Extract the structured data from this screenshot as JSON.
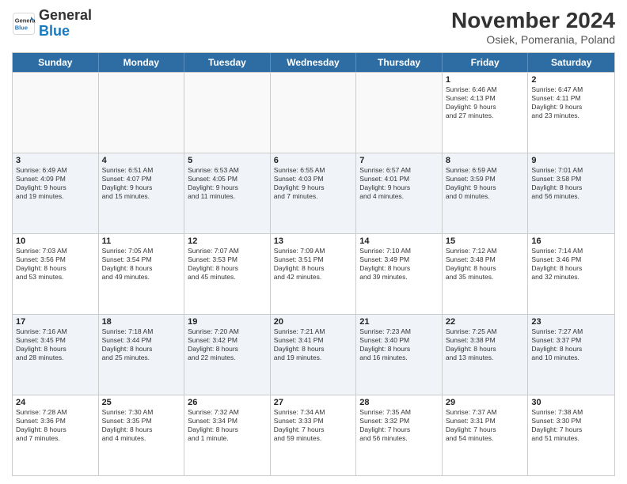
{
  "logo": {
    "general": "General",
    "blue": "Blue"
  },
  "header": {
    "month": "November 2024",
    "location": "Osiek, Pomerania, Poland"
  },
  "weekdays": [
    "Sunday",
    "Monday",
    "Tuesday",
    "Wednesday",
    "Thursday",
    "Friday",
    "Saturday"
  ],
  "rows": [
    [
      {
        "day": "",
        "info": ""
      },
      {
        "day": "",
        "info": ""
      },
      {
        "day": "",
        "info": ""
      },
      {
        "day": "",
        "info": ""
      },
      {
        "day": "",
        "info": ""
      },
      {
        "day": "1",
        "info": "Sunrise: 6:46 AM\nSunset: 4:13 PM\nDaylight: 9 hours\nand 27 minutes."
      },
      {
        "day": "2",
        "info": "Sunrise: 6:47 AM\nSunset: 4:11 PM\nDaylight: 9 hours\nand 23 minutes."
      }
    ],
    [
      {
        "day": "3",
        "info": "Sunrise: 6:49 AM\nSunset: 4:09 PM\nDaylight: 9 hours\nand 19 minutes."
      },
      {
        "day": "4",
        "info": "Sunrise: 6:51 AM\nSunset: 4:07 PM\nDaylight: 9 hours\nand 15 minutes."
      },
      {
        "day": "5",
        "info": "Sunrise: 6:53 AM\nSunset: 4:05 PM\nDaylight: 9 hours\nand 11 minutes."
      },
      {
        "day": "6",
        "info": "Sunrise: 6:55 AM\nSunset: 4:03 PM\nDaylight: 9 hours\nand 7 minutes."
      },
      {
        "day": "7",
        "info": "Sunrise: 6:57 AM\nSunset: 4:01 PM\nDaylight: 9 hours\nand 4 minutes."
      },
      {
        "day": "8",
        "info": "Sunrise: 6:59 AM\nSunset: 3:59 PM\nDaylight: 9 hours\nand 0 minutes."
      },
      {
        "day": "9",
        "info": "Sunrise: 7:01 AM\nSunset: 3:58 PM\nDaylight: 8 hours\nand 56 minutes."
      }
    ],
    [
      {
        "day": "10",
        "info": "Sunrise: 7:03 AM\nSunset: 3:56 PM\nDaylight: 8 hours\nand 53 minutes."
      },
      {
        "day": "11",
        "info": "Sunrise: 7:05 AM\nSunset: 3:54 PM\nDaylight: 8 hours\nand 49 minutes."
      },
      {
        "day": "12",
        "info": "Sunrise: 7:07 AM\nSunset: 3:53 PM\nDaylight: 8 hours\nand 45 minutes."
      },
      {
        "day": "13",
        "info": "Sunrise: 7:09 AM\nSunset: 3:51 PM\nDaylight: 8 hours\nand 42 minutes."
      },
      {
        "day": "14",
        "info": "Sunrise: 7:10 AM\nSunset: 3:49 PM\nDaylight: 8 hours\nand 39 minutes."
      },
      {
        "day": "15",
        "info": "Sunrise: 7:12 AM\nSunset: 3:48 PM\nDaylight: 8 hours\nand 35 minutes."
      },
      {
        "day": "16",
        "info": "Sunrise: 7:14 AM\nSunset: 3:46 PM\nDaylight: 8 hours\nand 32 minutes."
      }
    ],
    [
      {
        "day": "17",
        "info": "Sunrise: 7:16 AM\nSunset: 3:45 PM\nDaylight: 8 hours\nand 28 minutes."
      },
      {
        "day": "18",
        "info": "Sunrise: 7:18 AM\nSunset: 3:44 PM\nDaylight: 8 hours\nand 25 minutes."
      },
      {
        "day": "19",
        "info": "Sunrise: 7:20 AM\nSunset: 3:42 PM\nDaylight: 8 hours\nand 22 minutes."
      },
      {
        "day": "20",
        "info": "Sunrise: 7:21 AM\nSunset: 3:41 PM\nDaylight: 8 hours\nand 19 minutes."
      },
      {
        "day": "21",
        "info": "Sunrise: 7:23 AM\nSunset: 3:40 PM\nDaylight: 8 hours\nand 16 minutes."
      },
      {
        "day": "22",
        "info": "Sunrise: 7:25 AM\nSunset: 3:38 PM\nDaylight: 8 hours\nand 13 minutes."
      },
      {
        "day": "23",
        "info": "Sunrise: 7:27 AM\nSunset: 3:37 PM\nDaylight: 8 hours\nand 10 minutes."
      }
    ],
    [
      {
        "day": "24",
        "info": "Sunrise: 7:28 AM\nSunset: 3:36 PM\nDaylight: 8 hours\nand 7 minutes."
      },
      {
        "day": "25",
        "info": "Sunrise: 7:30 AM\nSunset: 3:35 PM\nDaylight: 8 hours\nand 4 minutes."
      },
      {
        "day": "26",
        "info": "Sunrise: 7:32 AM\nSunset: 3:34 PM\nDaylight: 8 hours\nand 1 minute."
      },
      {
        "day": "27",
        "info": "Sunrise: 7:34 AM\nSunset: 3:33 PM\nDaylight: 7 hours\nand 59 minutes."
      },
      {
        "day": "28",
        "info": "Sunrise: 7:35 AM\nSunset: 3:32 PM\nDaylight: 7 hours\nand 56 minutes."
      },
      {
        "day": "29",
        "info": "Sunrise: 7:37 AM\nSunset: 3:31 PM\nDaylight: 7 hours\nand 54 minutes."
      },
      {
        "day": "30",
        "info": "Sunrise: 7:38 AM\nSunset: 3:30 PM\nDaylight: 7 hours\nand 51 minutes."
      }
    ]
  ]
}
